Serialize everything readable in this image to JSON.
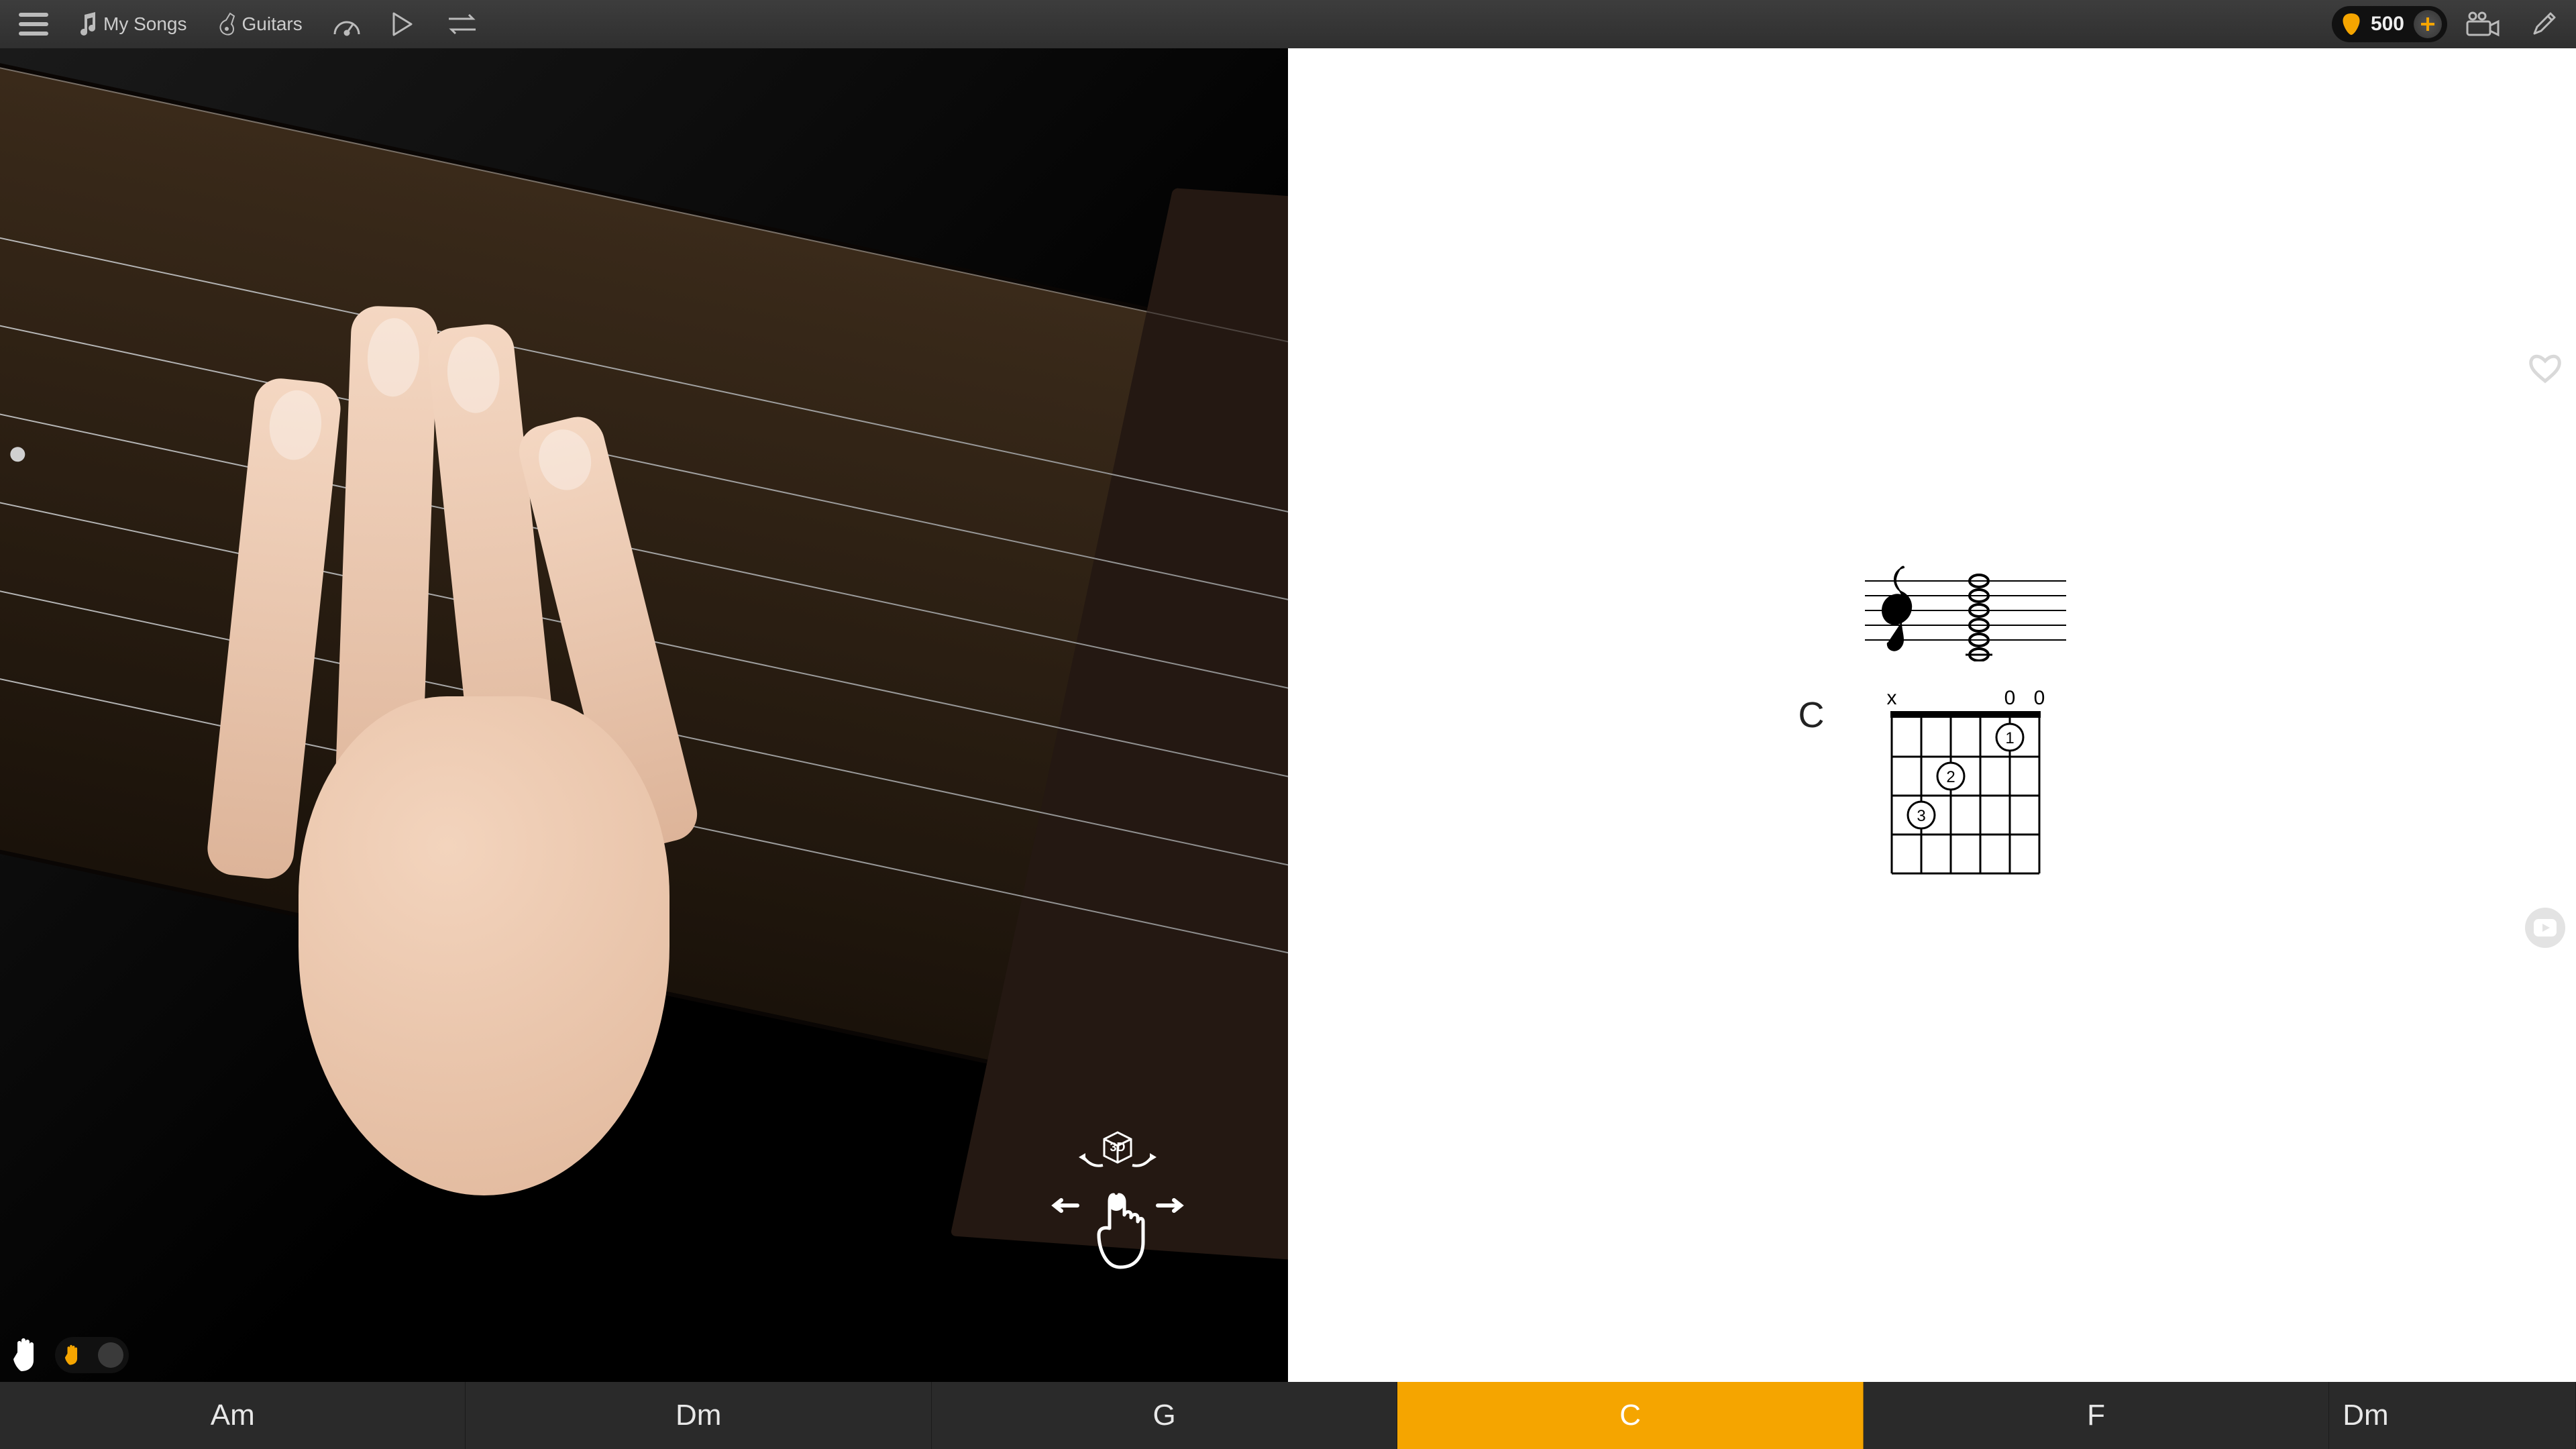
{
  "topbar": {
    "my_songs_label": "My Songs",
    "guitars_label": "Guitars"
  },
  "coins": {
    "count": "500"
  },
  "current_chord": {
    "name": "C",
    "open_strings_markers": [
      "x",
      "",
      "",
      "",
      "0",
      "0"
    ],
    "fingering": [
      {
        "string": 2,
        "fret": 1,
        "finger": "1"
      },
      {
        "string": 4,
        "fret": 2,
        "finger": "2"
      },
      {
        "string": 5,
        "fret": 3,
        "finger": "3"
      }
    ]
  },
  "view_hint": {
    "label_3d": "3D"
  },
  "chord_strip": {
    "items": [
      "Am",
      "Dm",
      "G",
      "C",
      "F",
      "Dm"
    ],
    "active_index": 3
  },
  "colors": {
    "accent": "#f5a500",
    "topbar": "#333333",
    "strip": "#2a2a2a"
  }
}
